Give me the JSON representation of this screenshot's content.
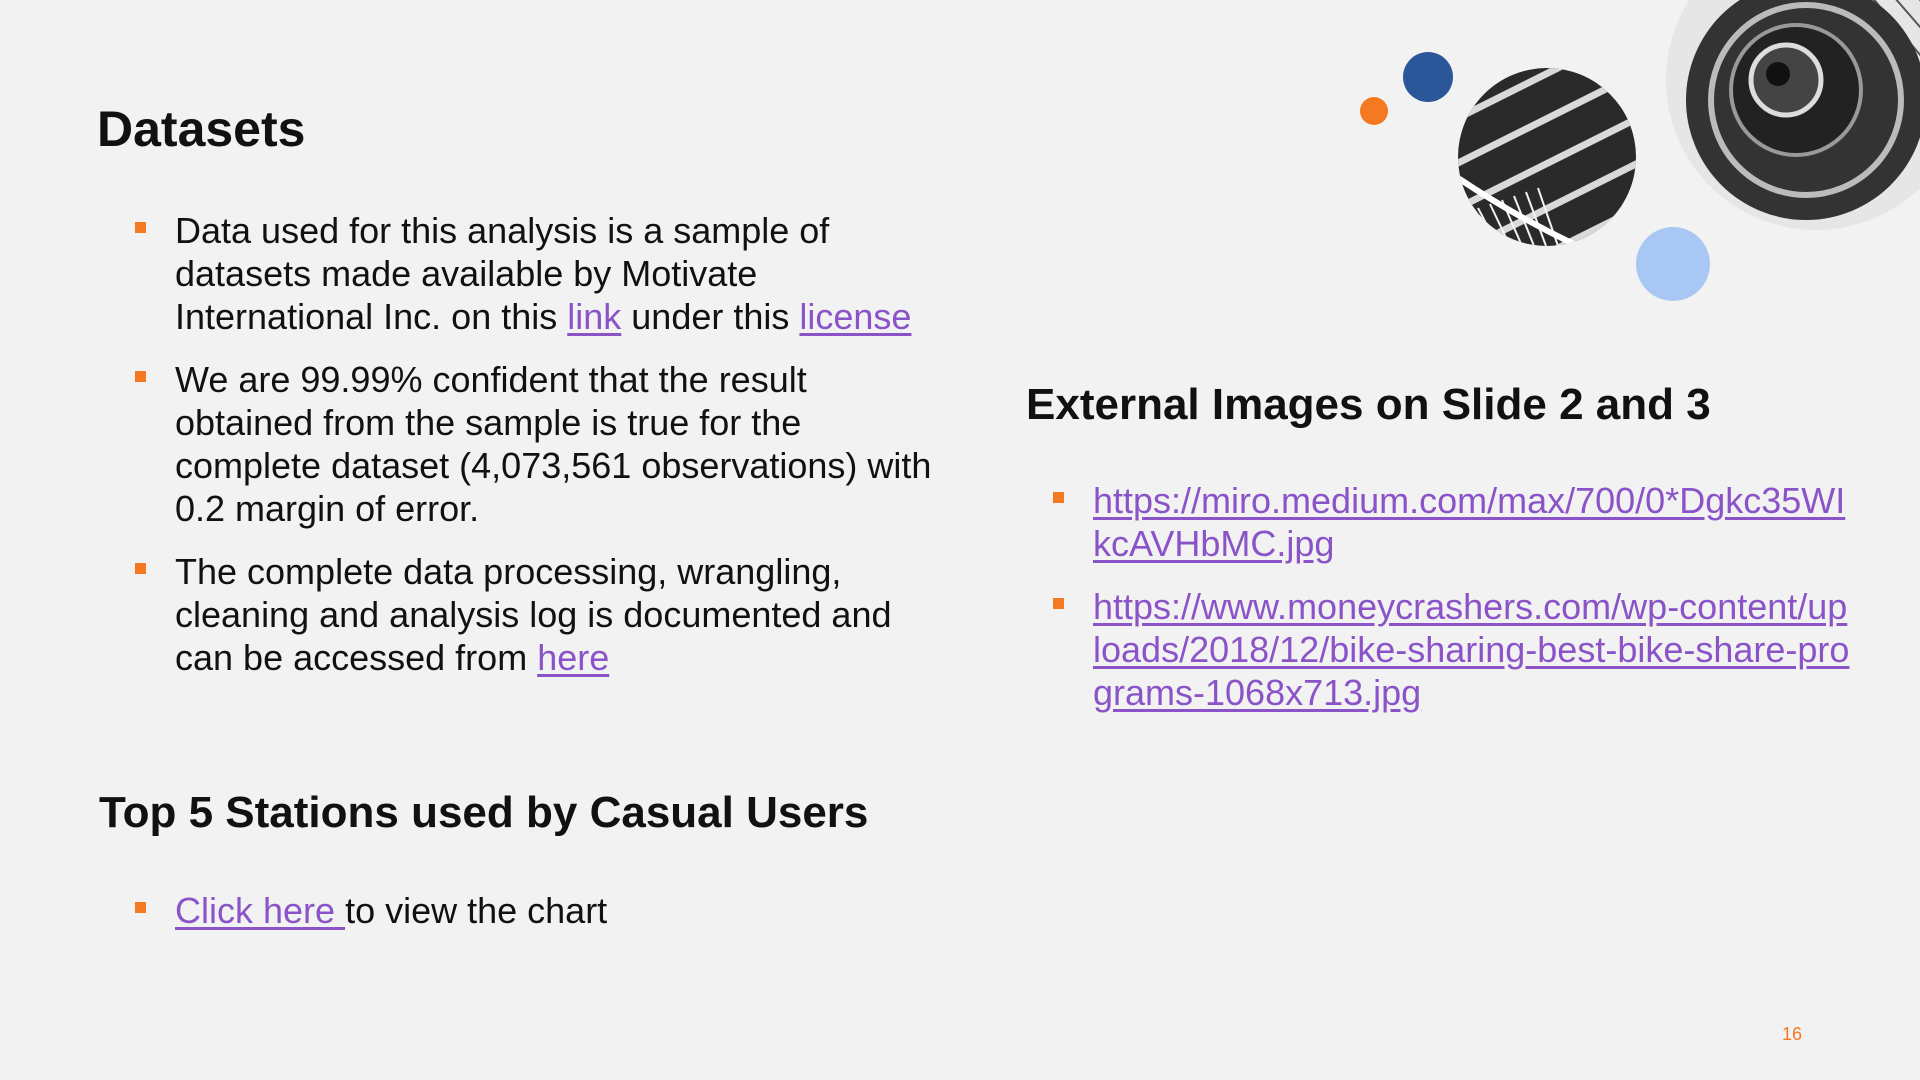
{
  "slide": {
    "datasets": {
      "heading": "Datasets",
      "bullet1": {
        "before": "Data used for this analysis is a sample of datasets made available by Motivate International Inc. on this ",
        "link1": "link",
        "middle": " under this ",
        "link2": "license"
      },
      "bullet2": "We are 99.99% confident that the result obtained from the sample is true for the complete dataset (4,073,561 observations) with 0.2 margin of error.",
      "bullet3": {
        "before": "The complete data processing, wrangling, cleaning and analysis log is documented and can be accessed from ",
        "link": "here"
      }
    },
    "top5": {
      "heading": "Top 5 Stations used by Casual Users",
      "bullet": {
        "link": "Click here ",
        "after": "to view the chart"
      }
    },
    "external": {
      "heading": "External Images on Slide 2 and 3",
      "links": [
        "https://miro.medium.com/max/700/0*Dgkc35WIkcAVHbMC.jpg",
        "https://www.moneycrashers.com/wp-content/uploads/2018/12/bike-sharing-best-bike-share-programs-1068x713.jpg"
      ]
    },
    "page_number": "16",
    "colors": {
      "background": "#f2f2f2",
      "accent_orange": "#f47920",
      "accent_blue": "#2b579a",
      "accent_light_blue": "#a9c7f5",
      "link": "#8a54c8"
    },
    "icons": [
      "square-bullet-icon"
    ]
  }
}
